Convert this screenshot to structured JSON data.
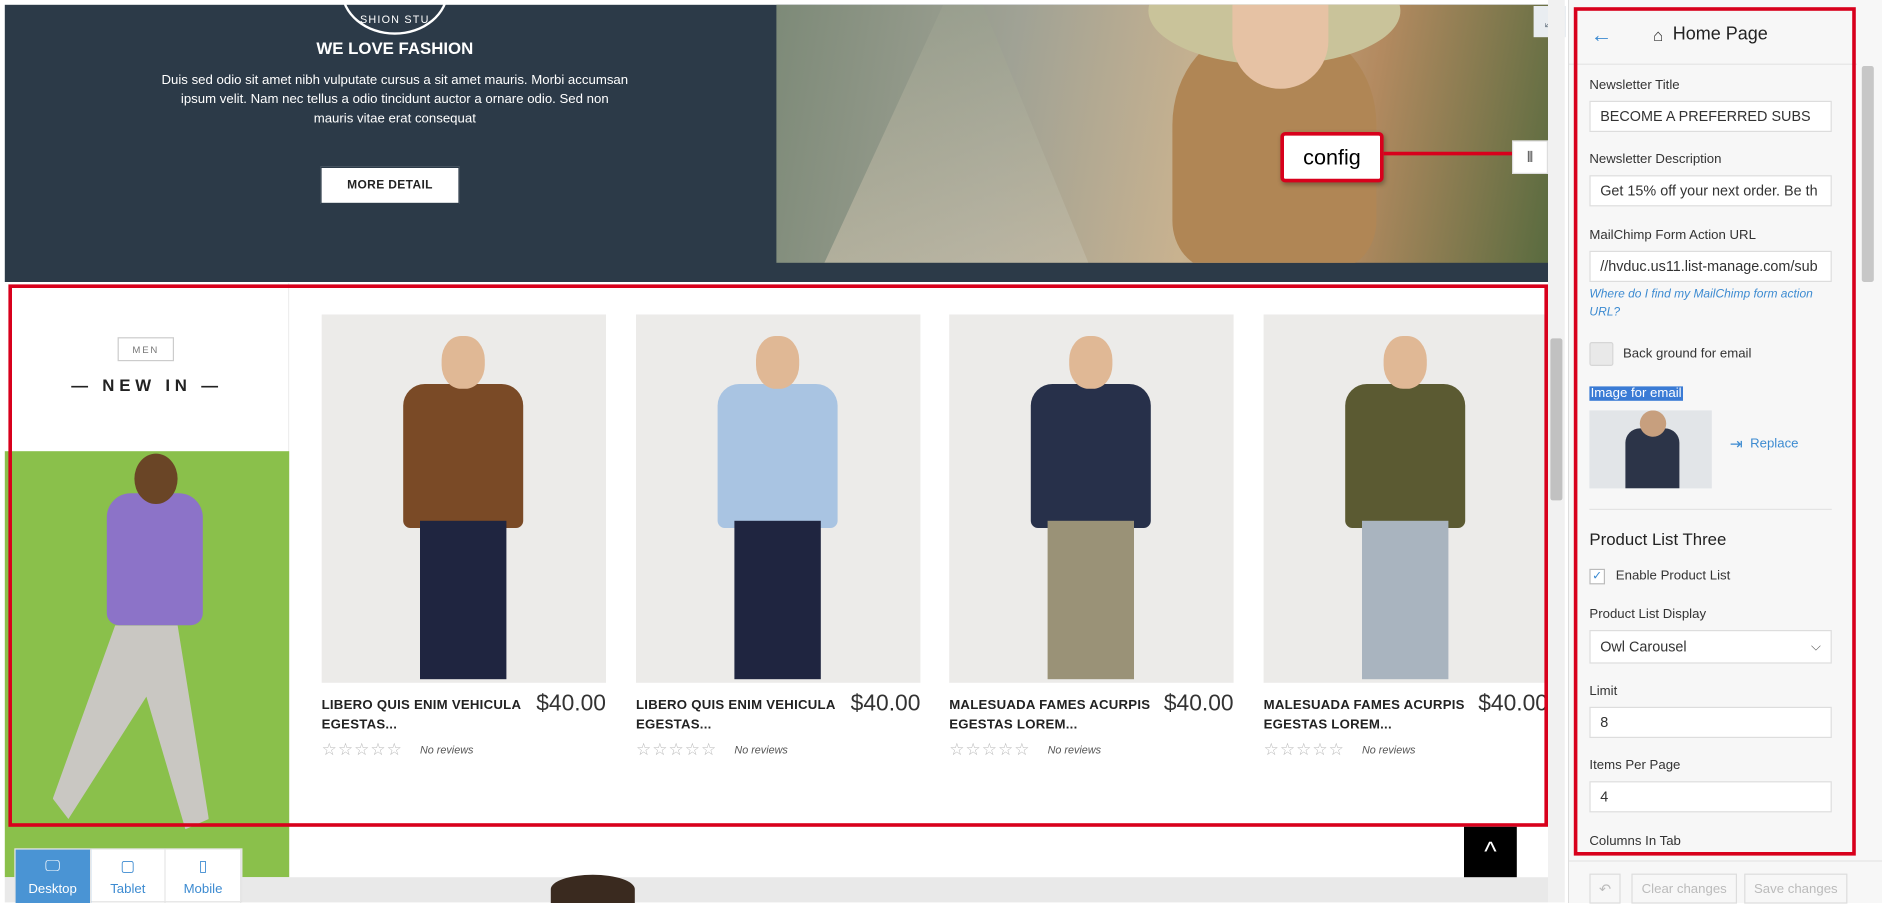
{
  "banner": {
    "logo_text": "SHION STU",
    "title": "WE LOVE FASHION",
    "text": "Duis sed odio sit amet nibh vulputate cursus a sit amet mauris. Morbi accumsan ipsum velit. Nam nec tellus a odio tincidunt auctor a ornare odio. Sed non mauris vitae erat consequat",
    "button": "MORE DETAIL",
    "expand_icon": "arrow-expand-icon"
  },
  "annotation": {
    "callout": "config",
    "handle_icon": "drag-handle-icon",
    "color": "#d8001c"
  },
  "section": {
    "tag": "MEN",
    "title": "— NEW IN —"
  },
  "products": [
    {
      "name": "LIBERO QUIS ENIM VEHICULA EGESTAS...",
      "price": "$40.00",
      "stars": "☆☆☆☆☆",
      "reviews": "No reviews",
      "body_color": "#7a4a26",
      "legs_color": "#1f2540"
    },
    {
      "name": "LIBERO QUIS ENIM VEHICULA EGESTAS...",
      "price": "$40.00",
      "stars": "☆☆☆☆☆",
      "reviews": "No reviews",
      "body_color": "#a9c4e2",
      "legs_color": "#1f2540"
    },
    {
      "name": "MALESUADA FAMES ACURPIS EGESTAS LOREM...",
      "price": "$40.00",
      "stars": "☆☆☆☆☆",
      "reviews": "No reviews",
      "body_color": "#27304a",
      "legs_color": "#9a9277"
    },
    {
      "name": "MALESUADA FAMES ACURPIS EGESTAS LOREM...",
      "price": "$40.00",
      "stars": "☆☆☆☆☆",
      "reviews": "No reviews",
      "body_color": "#5b5a32",
      "legs_color": "#a9b4bf"
    }
  ],
  "back_to_top": "^",
  "devices": [
    {
      "label": "Desktop",
      "icon": "desktop-icon",
      "glyph": "🖵",
      "active": true
    },
    {
      "label": "Tablet",
      "icon": "tablet-icon",
      "glyph": "▢",
      "active": false
    },
    {
      "label": "Mobile",
      "icon": "mobile-icon",
      "glyph": "▯",
      "active": false
    }
  ],
  "panel": {
    "back_icon": "←",
    "home_icon": "⌂",
    "title": "Home Page",
    "newsletter_title_label": "Newsletter Title",
    "newsletter_title_value": "BECOME A PREFERRED SUBS",
    "newsletter_desc_label": "Newsletter Description",
    "newsletter_desc_value": "Get 15% off your next order. Be th",
    "mailchimp_label": "MailChimp Form Action URL",
    "mailchimp_value": "//hvduc.us11.list-manage.com/sub",
    "mailchimp_help": "Where do I find my MailChimp form action URL?",
    "bg_email_label": "Back ground for email",
    "image_email_label": "Image for email",
    "replace_label": "Replace",
    "product_list_title": "Product List Three",
    "enable_product_list_label": "Enable Product List",
    "enable_product_list_checked": "✓",
    "display_label": "Product List Display",
    "display_value": "Owl Carousel",
    "display_chevron": "⌵",
    "limit_label": "Limit",
    "limit_value": "8",
    "items_per_page_label": "Items Per Page",
    "items_per_page_value": "4",
    "columns_in_tab_label": "Columns In Tab",
    "undo_icon": "↶",
    "clear_changes": "Clear changes",
    "save_changes": "Save changes"
  }
}
